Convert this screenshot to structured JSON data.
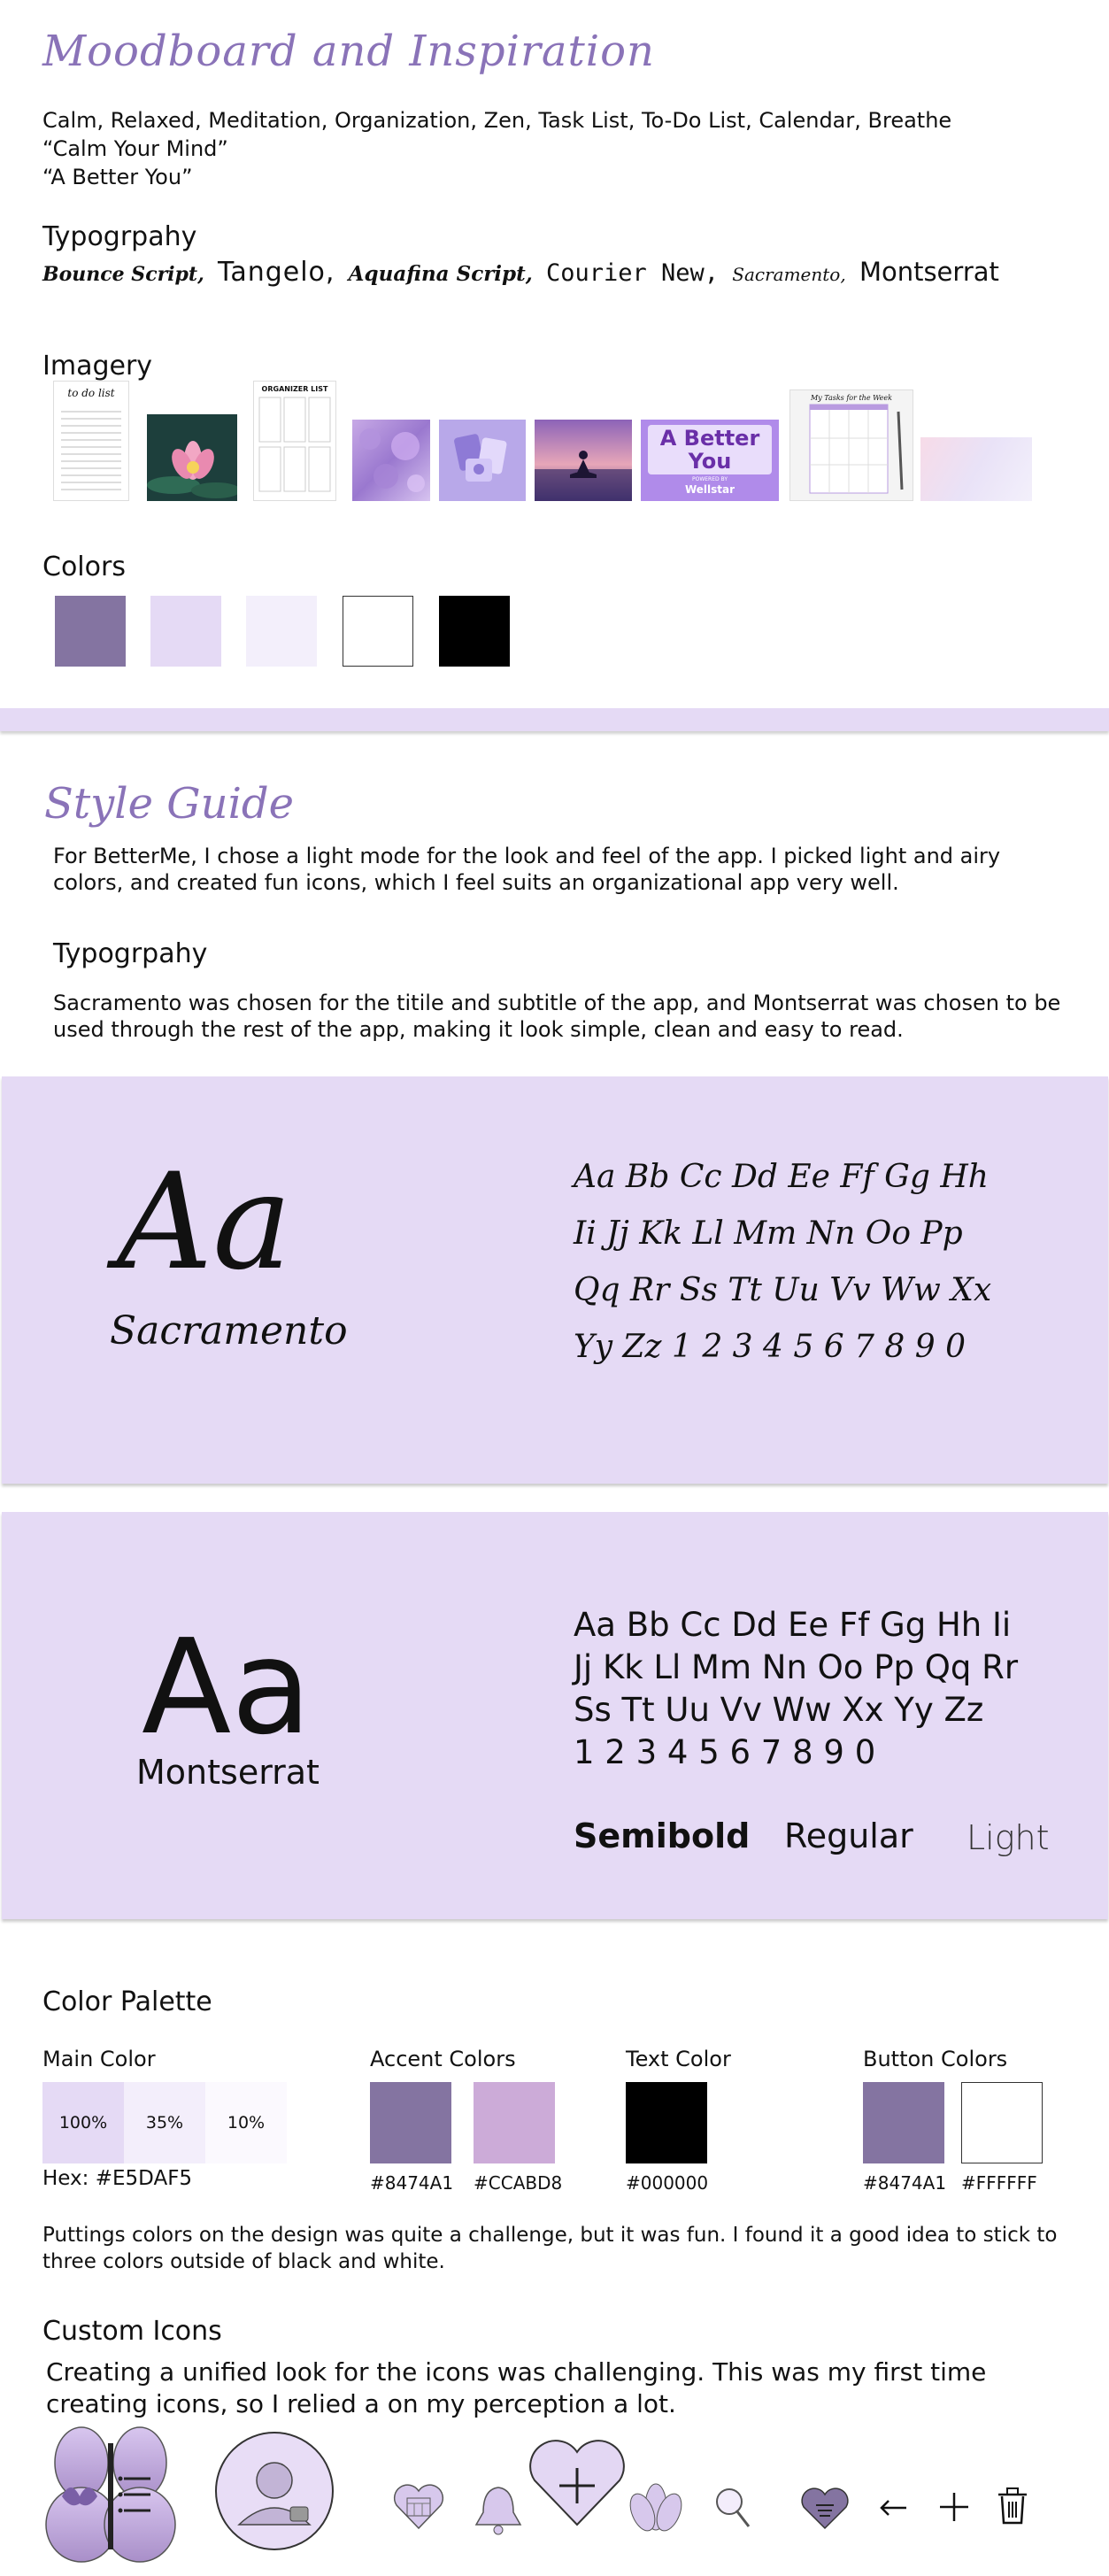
{
  "moodboard": {
    "title": "Moodboard and Inspiration",
    "keywords": "Calm, Relaxed, Meditation, Organization, Zen, Task List, To-Do List, Calendar, Breathe",
    "quote1": "“Calm Your Mind”",
    "quote2": "“A Better You”",
    "typography_heading": "Typogrpahy",
    "fonts": [
      "Bounce Script,",
      "Tangelo,",
      "Aquafina Script,",
      "Courier New,",
      "Sacramento,",
      "Montserrat"
    ],
    "imagery_heading": "Imagery",
    "imagery": {
      "todo_label": "to do list",
      "organizer_label": "ORGANIZER LIST",
      "banner_line1": "A Better",
      "banner_line2": "You",
      "banner_sub": "POWERED BY",
      "banner_brand": "Wellstar",
      "planner_label": "My Tasks for the Week"
    },
    "colors_heading": "Colors",
    "colors": [
      "#8474A1",
      "#E5DAF5",
      "#F3EFFB",
      "#FFFFFF",
      "#000000"
    ]
  },
  "style_guide": {
    "title": "Style Guide",
    "intro": "For BetterMe, I chose a light mode for the look and feel of the app.  I picked light and airy colors, and created fun icons, which I feel suits an organizational app very well.",
    "typography_heading": "Typogrpahy",
    "typography_text": "Sacramento was chosen for the titile and subtitle of the app, and Montserrat was chosen to be used through the rest of the app, making it look simple, clean and easy to read."
  },
  "sacramento_panel": {
    "sample": "Aa",
    "font_name": "Sacramento",
    "alphabet": [
      "Aa Bb Cc Dd Ee Ff Gg Hh",
      "Ii Jj Kk Ll Mm Nn Oo Pp",
      "Qq Rr Ss Tt Uu Vv Ww Xx",
      "Yy Zz 1 2 3 4 5 6 7 8 9 0"
    ]
  },
  "montserrat_panel": {
    "sample": "Aa",
    "font_name": "Montserrat",
    "alphabet": [
      "Aa Bb Cc Dd Ee Ff Gg Hh Ii",
      "Jj Kk Ll Mm Nn Oo Pp Qq Rr",
      "Ss Tt Uu Vv Ww Xx Yy Zz",
      "1 2 3 4 5 6 7 8 9 0"
    ],
    "weights": [
      "Semibold",
      "Regular",
      "Light"
    ]
  },
  "color_palette": {
    "heading": "Color Palette",
    "main": {
      "label": "Main Color",
      "tints": [
        {
          "pct": "100%",
          "color": "#E5DAF5"
        },
        {
          "pct": "35%",
          "color": "#F3EEFB"
        },
        {
          "pct": "10%",
          "color": "#FBF9FE"
        }
      ],
      "hex": "Hex: #E5DAF5"
    },
    "accent": {
      "label": "Accent Colors",
      "swatches": [
        {
          "color": "#8474A1",
          "hex": "#8474A1"
        },
        {
          "color": "#CCABD8",
          "hex": "#CCABD8"
        }
      ]
    },
    "text": {
      "label": "Text Color",
      "swatches": [
        {
          "color": "#000000",
          "hex": "#000000"
        }
      ]
    },
    "button": {
      "label": "Button Colors",
      "swatches": [
        {
          "color": "#8474A1",
          "hex": "#8474A1"
        },
        {
          "color": "#FFFFFF",
          "hex": "#FFFFFF"
        }
      ]
    },
    "note": "Puttings colors on the design was quite a challenge, but it was fun.  I found it a good idea to stick to three colors outside of black and white."
  },
  "custom_icons": {
    "heading": "Custom Icons",
    "text": "Creating a unified look for the icons was challenging.  This was my first time creating icons, so I relied a on my perception a lot."
  }
}
